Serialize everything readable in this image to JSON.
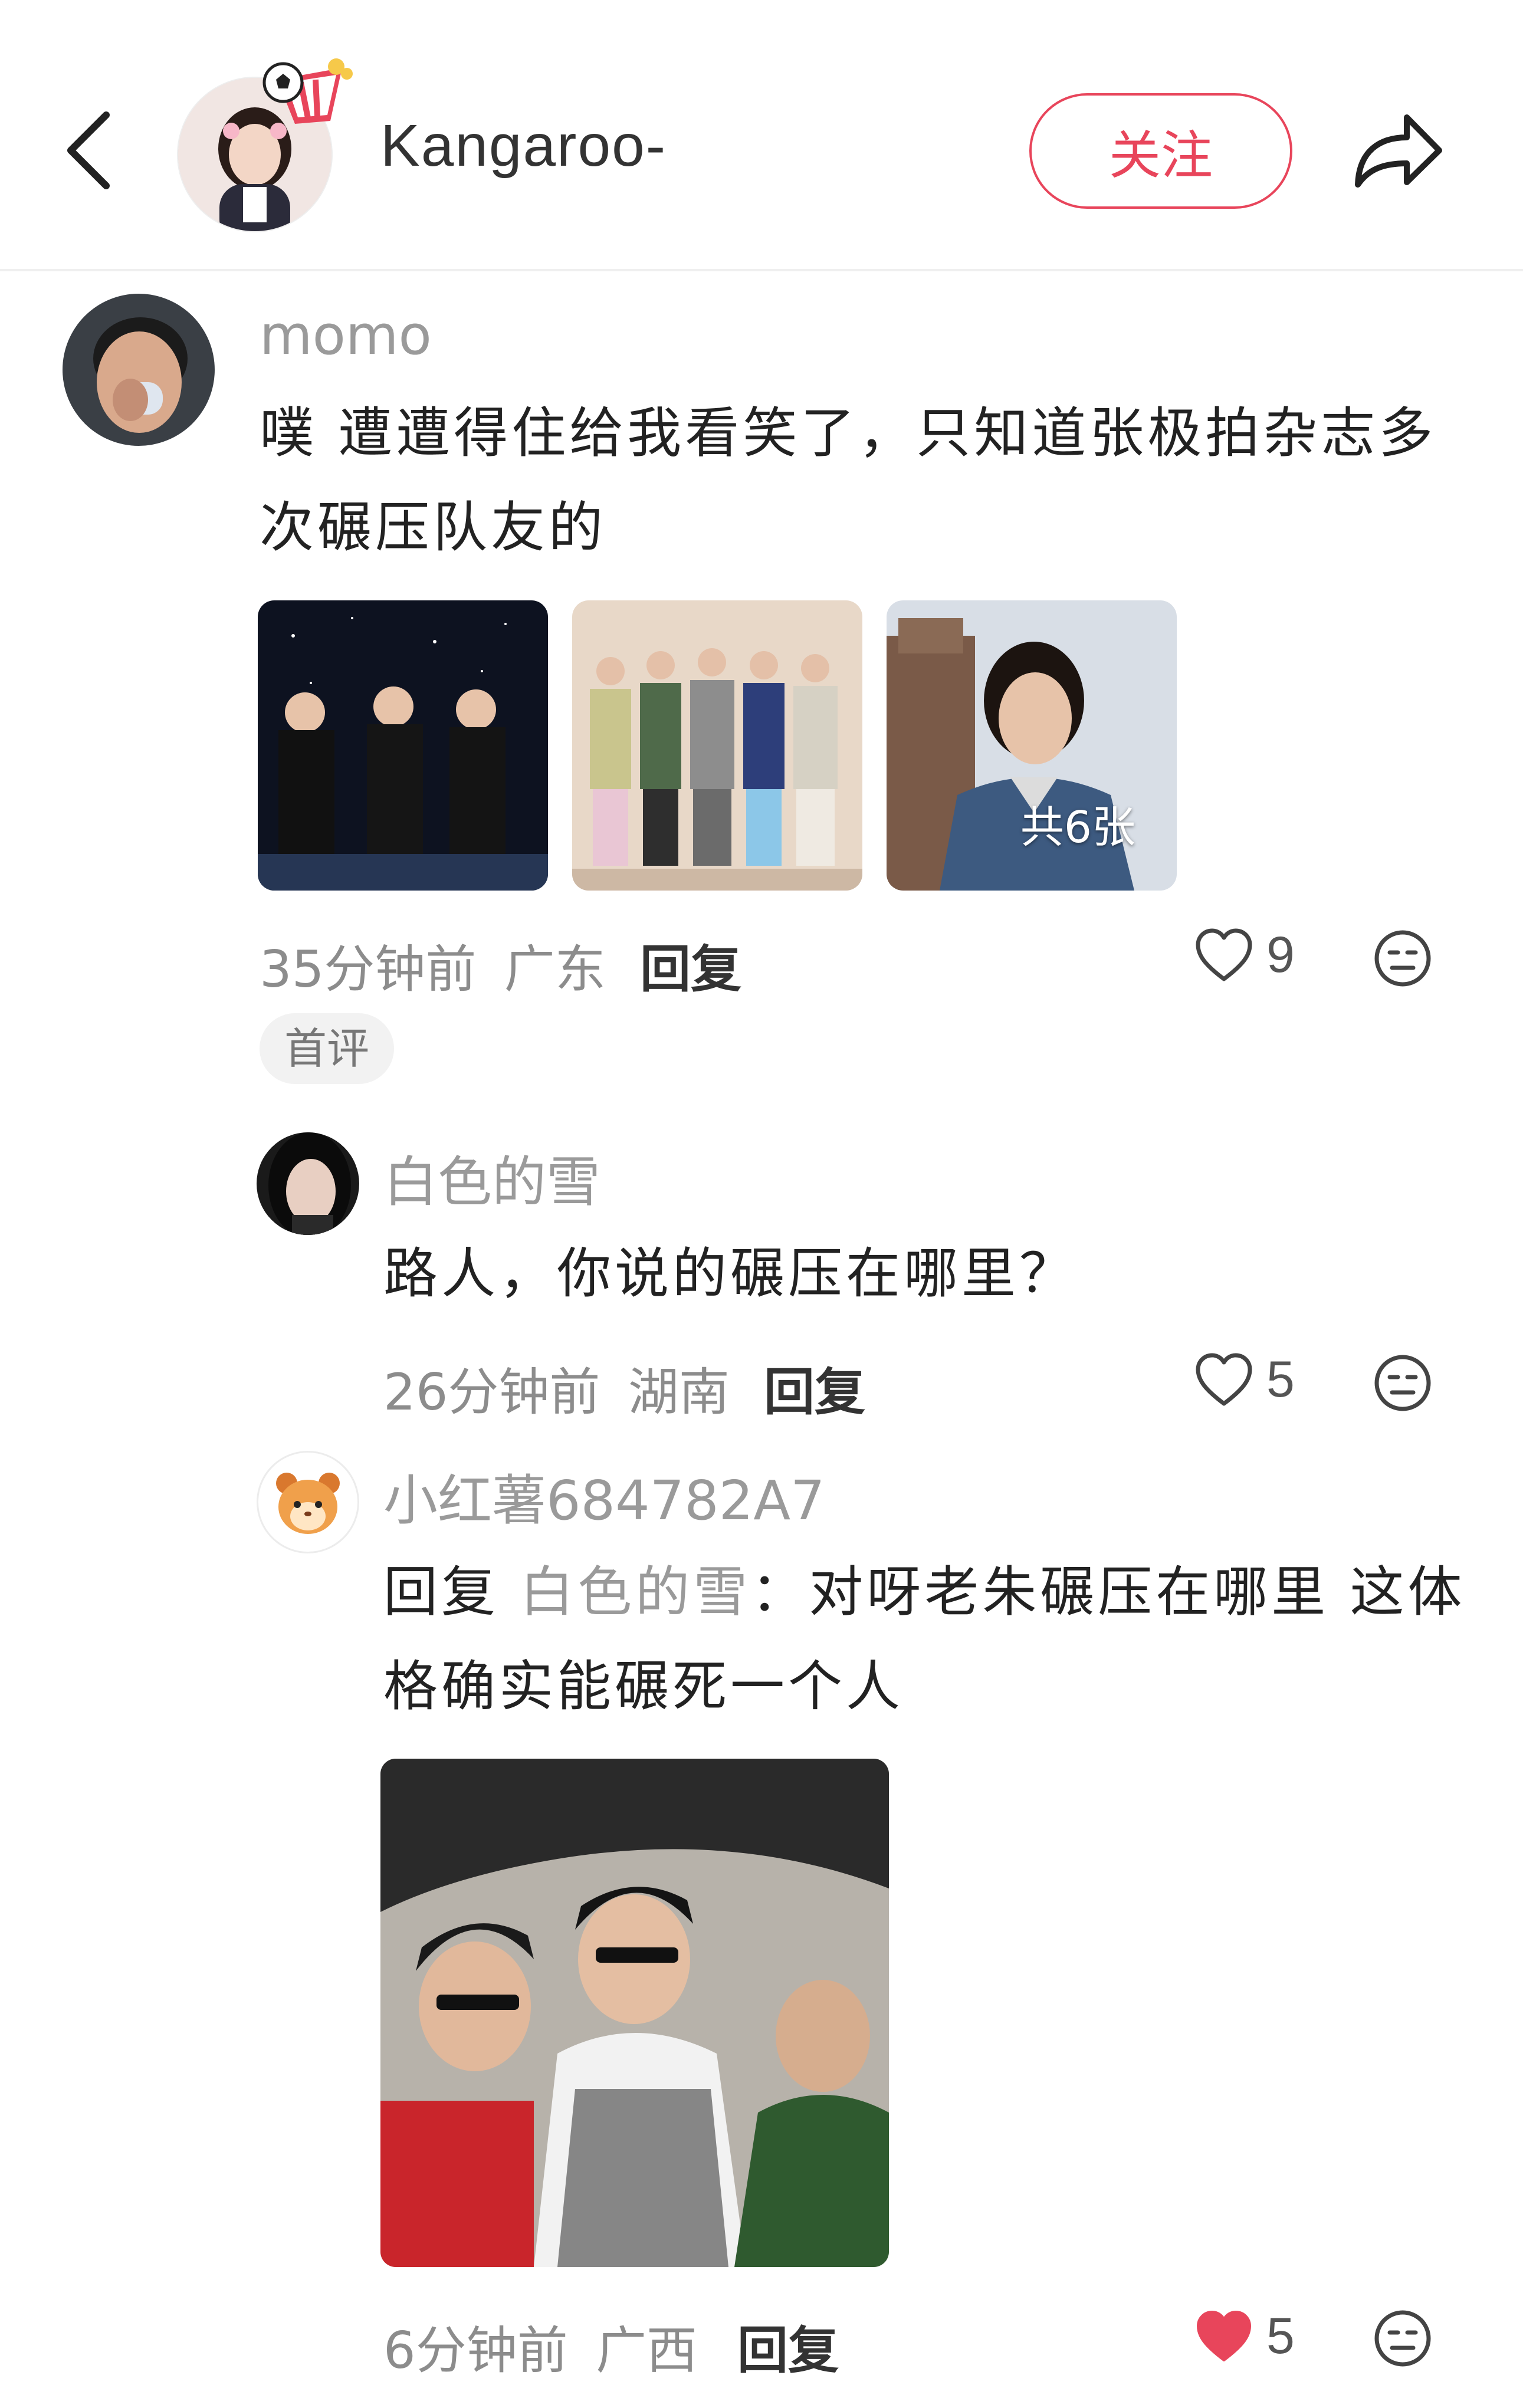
{
  "header": {
    "author_name": "Kangaroo-",
    "follow_label": "关注"
  },
  "comments": [
    {
      "user": "momo",
      "text": "噗 遭遭得住给我看笑了，只知道张极拍杂志多次碾压队友的",
      "images_more_label": "共6张",
      "time": "35分钟前",
      "location": "广东",
      "reply_label": "回复",
      "likes": "9",
      "liked": false,
      "tag": "首评"
    }
  ],
  "replies": [
    {
      "user": "白色的雪",
      "text": "路人，你说的碾压在哪里？",
      "time": "26分钟前",
      "location": "湖南",
      "reply_label": "回复",
      "likes": "5",
      "liked": false
    },
    {
      "user": "小红薯684782A7",
      "reply_prefix": "回复 ",
      "reply_target": "白色的雪",
      "text": "：对呀老朱碾压在哪里 这体格确实能碾死一个人",
      "time": "6分钟前",
      "location": "广西",
      "reply_label": "回复",
      "likes": "5",
      "liked": true
    }
  ],
  "colors": {
    "accent": "#e8455b",
    "like_active": "#e8455b",
    "secondary_text": "#9a9a9a"
  }
}
